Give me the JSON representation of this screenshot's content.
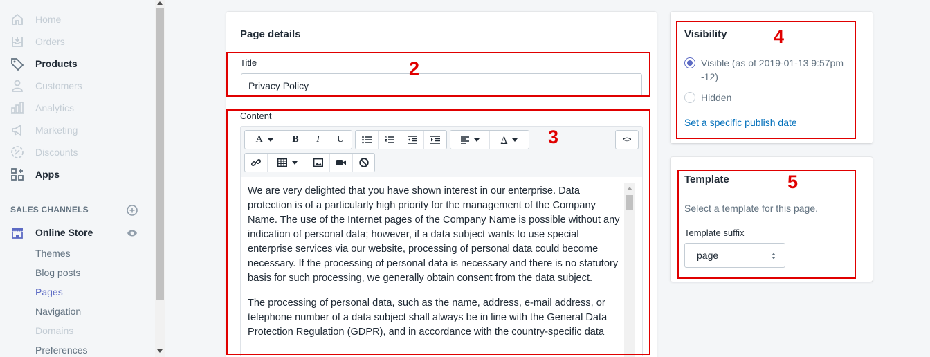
{
  "sidebar": {
    "items": [
      {
        "label": "Home",
        "icon": "home-icon"
      },
      {
        "label": "Orders",
        "icon": "orders-icon"
      },
      {
        "label": "Products",
        "icon": "tag-icon"
      },
      {
        "label": "Customers",
        "icon": "user-icon"
      },
      {
        "label": "Analytics",
        "icon": "analytics-icon"
      },
      {
        "label": "Marketing",
        "icon": "megaphone-icon"
      },
      {
        "label": "Discounts",
        "icon": "discount-icon"
      },
      {
        "label": "Apps",
        "icon": "apps-icon"
      }
    ],
    "sales_channels_title": "SALES CHANNELS",
    "online_store": "Online Store",
    "sub_items": [
      "Themes",
      "Blog posts",
      "Pages",
      "Navigation",
      "Domains",
      "Preferences"
    ]
  },
  "page_details": {
    "title": "Page details",
    "title_label": "Title",
    "title_value": "Privacy Policy",
    "content_label": "Content",
    "paragraphs": [
      "We are very delighted that you have shown interest in our enterprise. Data protection is of a particularly high priority for the management of the Company Name. The use of the Internet pages of the Company Name is possible without any indication of personal data; however, if a data subject wants to use special enterprise services via our website, processing of personal data could become necessary. If the processing of personal data is necessary and there is no statutory basis for such processing, we generally obtain consent from the data subject.",
      "The processing of personal data, such as the name, address, e-mail address, or telephone number of a data subject shall always be in line with the General Data Protection Regulation (GDPR), and in accordance with the country-specific data"
    ]
  },
  "toolbar": {
    "font": "A",
    "bold": "B",
    "italic": "I",
    "underline": "U",
    "code": "<>"
  },
  "visibility": {
    "title": "Visibility",
    "visible_label": "Visible (as of 2019-01-13 9:57pm -12)",
    "hidden_label": "Hidden",
    "selected": "Visible",
    "publish_link": "Set a specific publish date"
  },
  "template": {
    "title": "Template",
    "help": "Select a template for this page.",
    "suffix_label": "Template suffix",
    "suffix_value": "page"
  },
  "annotations": [
    "2",
    "3",
    "4",
    "5"
  ],
  "colors": {
    "accent": "#5c6ac4",
    "link": "#006fbb",
    "annotation": "#e00000"
  }
}
